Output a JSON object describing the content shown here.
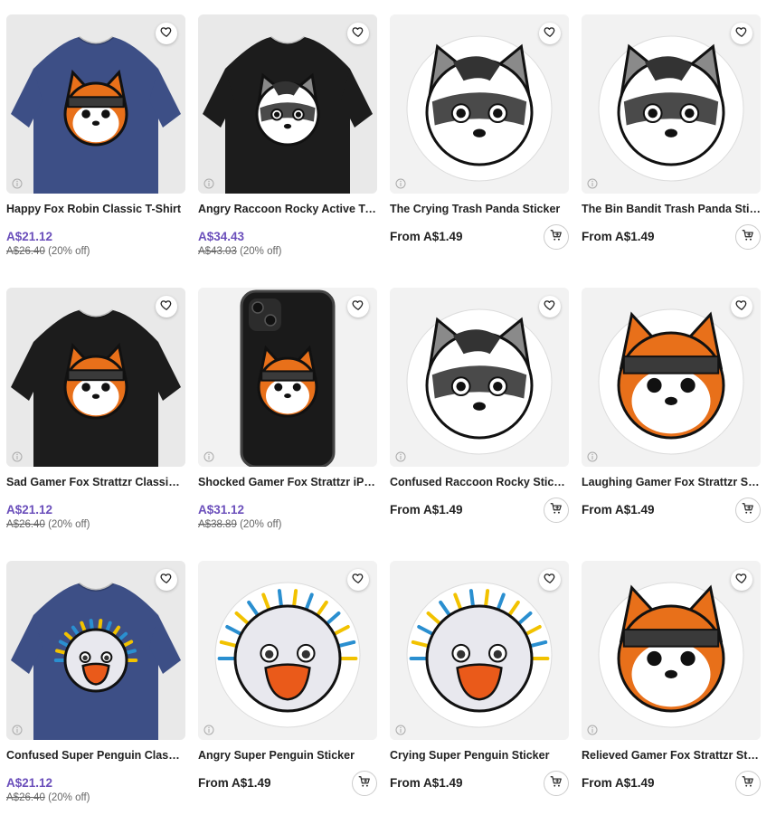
{
  "colors": {
    "accent_price": "#6b4fbb",
    "card_bg": "#f2f2f2"
  },
  "products": [
    {
      "title": "Happy Fox Robin Classic T-Shirt",
      "price": "A$21.12",
      "original": "A$26.40",
      "discount": "(20% off)",
      "kind": "shirt",
      "shirt_color": "#3d4f86",
      "face": "fox"
    },
    {
      "title": "Angry Raccoon Rocky Active T-…",
      "price": "A$34.43",
      "original": "A$43.03",
      "discount": "(20% off)",
      "kind": "shirt",
      "shirt_color": "#1c1c1c",
      "face": "raccoon"
    },
    {
      "title": "The Crying Trash Panda Sticker",
      "price": "From A$1.49",
      "kind": "sticker",
      "face": "raccoon"
    },
    {
      "title": "The Bin Bandit Trash Panda Stic…",
      "price": "From A$1.49",
      "kind": "sticker",
      "face": "raccoon"
    },
    {
      "title": "Sad Gamer Fox Strattzr Classic …",
      "price": "A$21.12",
      "original": "A$26.40",
      "discount": "(20% off)",
      "kind": "shirt",
      "shirt_color": "#1c1c1c",
      "face": "fox"
    },
    {
      "title": "Shocked Gamer Fox Strattzr iPh…",
      "price": "A$31.12",
      "original": "A$38.89",
      "discount": "(20% off)",
      "kind": "phone",
      "face": "fox"
    },
    {
      "title": "Confused Raccoon Rocky Sticker",
      "price": "From A$1.49",
      "kind": "sticker",
      "face": "raccoon"
    },
    {
      "title": "Laughing Gamer Fox Strattzr St…",
      "price": "From A$1.49",
      "kind": "sticker",
      "face": "fox"
    },
    {
      "title": "Confused Super Penguin Classi…",
      "price": "A$21.12",
      "original": "A$26.40",
      "discount": "(20% off)",
      "kind": "shirt",
      "shirt_color": "#3d4f86",
      "face": "penguin"
    },
    {
      "title": "Angry Super Penguin Sticker",
      "price": "From A$1.49",
      "kind": "sticker",
      "face": "penguin"
    },
    {
      "title": "Crying Super Penguin Sticker",
      "price": "From A$1.49",
      "kind": "sticker",
      "face": "penguin"
    },
    {
      "title": "Relieved Gamer Fox Strattzr Sti…",
      "price": "From A$1.49",
      "kind": "sticker",
      "face": "fox"
    }
  ]
}
